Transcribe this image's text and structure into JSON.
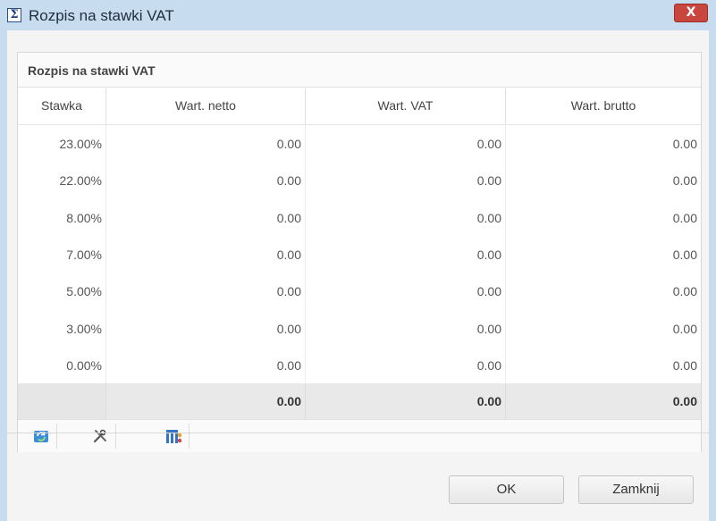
{
  "window": {
    "title": "Rozpis na stawki VAT",
    "close_label": "X",
    "title_icon": "sigma-icon",
    "title_icon_glyph": "Σ"
  },
  "panel": {
    "title": "Rozpis na stawki VAT"
  },
  "table": {
    "columns": [
      "Stawka",
      "Wart. netto",
      "Wart. VAT",
      "Wart. brutto"
    ],
    "rows": [
      [
        "23.00%",
        "0.00",
        "0.00",
        "0.00"
      ],
      [
        "22.00%",
        "0.00",
        "0.00",
        "0.00"
      ],
      [
        "8.00%",
        "0.00",
        "0.00",
        "0.00"
      ],
      [
        "7.00%",
        "0.00",
        "0.00",
        "0.00"
      ],
      [
        "5.00%",
        "0.00",
        "0.00",
        "0.00"
      ],
      [
        "3.00%",
        "0.00",
        "0.00",
        "0.00"
      ],
      [
        "0.00%",
        "0.00",
        "0.00",
        "0.00"
      ]
    ],
    "summary": [
      "",
      "0.00",
      "0.00",
      "0.00"
    ]
  },
  "toolbar": {
    "buttons": [
      "refresh-icon",
      "settings-tools-icon",
      "columns-icon"
    ]
  },
  "footer": {
    "ok_label": "OK",
    "close_label": "Zamknij"
  },
  "colors": {
    "titlebar": "#c7dcef",
    "close_button": "#c8463d",
    "summary_row": "#e9e9e9"
  }
}
